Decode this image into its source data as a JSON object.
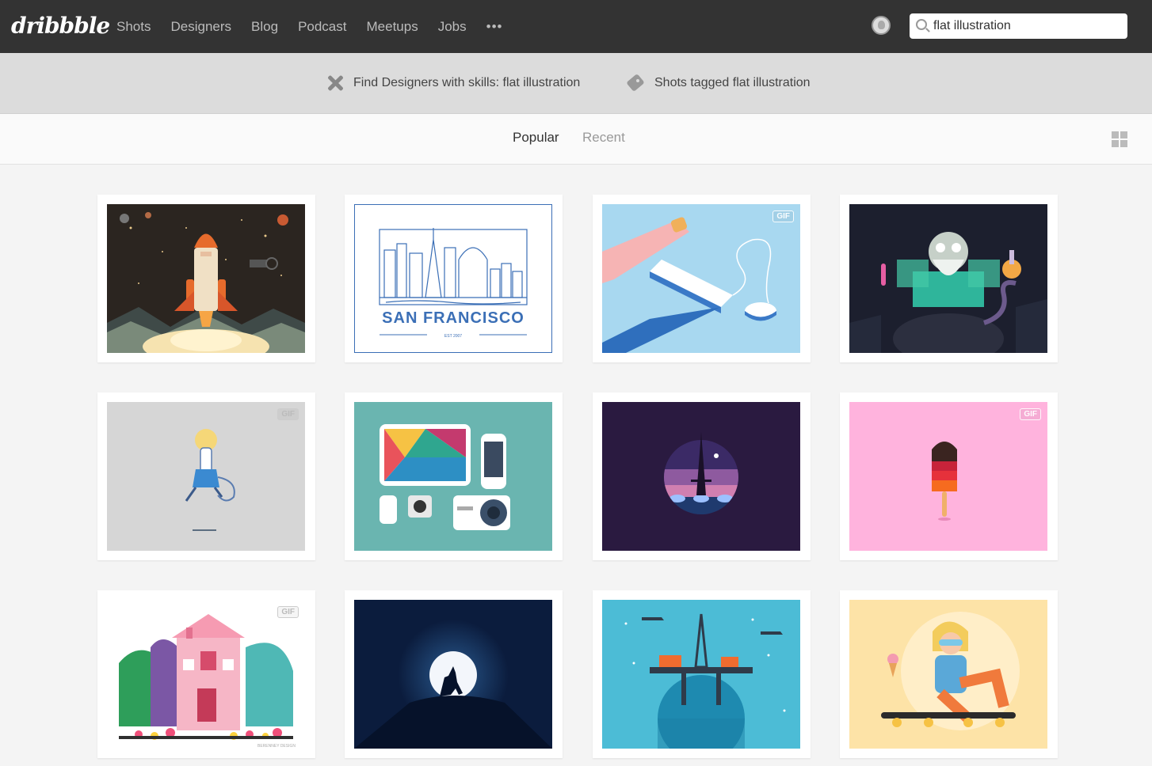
{
  "header": {
    "logo_text": "dribbble",
    "nav": [
      "Shots",
      "Designers",
      "Blog",
      "Podcast",
      "Meetups",
      "Jobs"
    ],
    "more_label": "•••",
    "search_value": "flat illustration"
  },
  "suggestions": {
    "designers": "Find Designers with skills: flat illustration",
    "tagged": "Shots tagged flat illustration"
  },
  "filters": {
    "popular": "Popular",
    "recent": "Recent"
  },
  "shots": [
    {
      "label": "rocket launch illustration",
      "bg": "#2b2520"
    },
    {
      "label": "San Francisco line art",
      "bg": "#ffffff",
      "caption": "SAN FRANCISCO",
      "sub": "EST 2007"
    },
    {
      "label": "desk arm keyboard",
      "bg": "#a8d8f0",
      "gif": "GIF"
    },
    {
      "label": "mad scientist",
      "bg": "#1c1f2e"
    },
    {
      "label": "running girl",
      "bg": "#d6d6d6",
      "gif": "GIF"
    },
    {
      "label": "devices flatlay",
      "bg": "#6ab5b0"
    },
    {
      "label": "eiffel tower night",
      "bg": "#2a1a40"
    },
    {
      "label": "popsicle",
      "bg": "#ffb3dd",
      "gif": "GIF"
    },
    {
      "label": "pink house",
      "bg": "#ffffff",
      "gif": "GIF",
      "credit": "BERENNEY DESIGN"
    },
    {
      "label": "wolf moon",
      "bg": "#0b1c3d"
    },
    {
      "label": "oil rig",
      "bg": "#4cbcd6"
    },
    {
      "label": "skateboard girl",
      "bg": "#fde3a7"
    }
  ]
}
